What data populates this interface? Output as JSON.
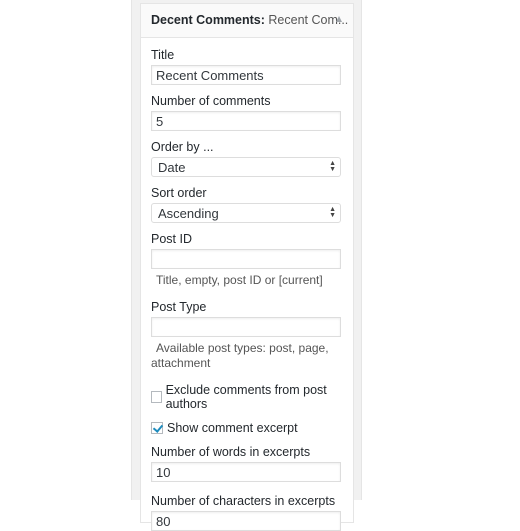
{
  "widget": {
    "title_bold": "Decent Comments:",
    "title_sub": " Recent Com...",
    "fields": {
      "title": {
        "label": "Title",
        "value": "Recent Comments"
      },
      "number": {
        "label": "Number of comments",
        "value": "5"
      },
      "order_by": {
        "label": "Order by ...",
        "value": "Date"
      },
      "sort_order": {
        "label": "Sort order",
        "value": "Ascending"
      },
      "post_id": {
        "label": "Post ID",
        "value": "",
        "description": "Title, empty, post ID or [current]"
      },
      "post_type": {
        "label": "Post Type",
        "value": "",
        "description_line1": "Available post types: post, page,",
        "description_line2": "attachment"
      },
      "exclude": {
        "label": "Exclude comments from post authors",
        "checked": false
      },
      "show_excerpt": {
        "label": "Show comment excerpt",
        "checked": true
      },
      "words": {
        "label": "Number of words in excerpts",
        "value": "10"
      },
      "chars": {
        "label": "Number of characters in excerpts",
        "value": "80"
      }
    }
  }
}
